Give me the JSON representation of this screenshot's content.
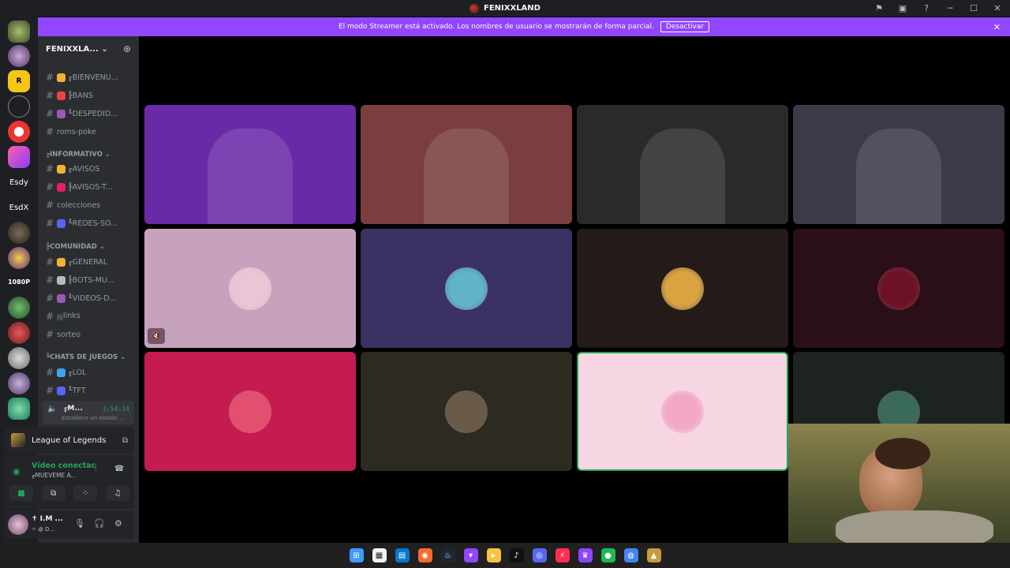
{
  "window": {
    "title": "FENIXXLAND",
    "controls": [
      "flag-icon",
      "inbox-icon",
      "help-icon",
      "minimize-icon",
      "maximize-icon",
      "close-icon"
    ],
    "control_glyphs": [
      "⚑",
      "▣",
      "?",
      "─",
      "☐",
      "✕"
    ]
  },
  "banner": {
    "message": "El modo Streamer está activado. Los nombres de usuario se mostrarán de forma parcial.",
    "button": "Desactivar",
    "close": "✕",
    "color": "#9146ff"
  },
  "rail": {
    "labels": [
      "Esdy",
      "EsdX",
      "1080P"
    ]
  },
  "guild": {
    "name": "FENIXXLA...",
    "chevron": "⌄",
    "add_icon": "⊕"
  },
  "channels": [
    {
      "label": "╓BIENVENU...",
      "color": "#f0b232"
    },
    {
      "label": "╟BANS",
      "color": "#f23f43"
    },
    {
      "label": "╙DESPEDID...",
      "color": "#9b59b6"
    },
    {
      "label": "roms-poke",
      "color": ""
    }
  ],
  "categories": [
    "╔INFORMATIVO ⌄",
    "╠COMUNIDAD ⌄",
    "╚CHATS DE JUEGOS ⌄"
  ],
  "info_channels": [
    {
      "label": "╓AVISOS",
      "color": "#f0b232"
    },
    {
      "label": "╟AVISOS-T...",
      "color": "#e91e63"
    },
    {
      "label": "colecciones",
      "color": ""
    },
    {
      "label": "╙REDES-SO...",
      "color": "#5865f2"
    }
  ],
  "community_channels": [
    {
      "label": "╓GENERAL",
      "color": "#f0b232"
    },
    {
      "label": "╟BOTS-MU...",
      "color": "#b5bac1"
    },
    {
      "label": "╙VIDEOS-D...",
      "color": "#9b59b6"
    },
    {
      "label": "ஜlinks",
      "color": ""
    },
    {
      "label": "sorteo",
      "color": ""
    }
  ],
  "games_channels": [
    {
      "label": "╓LOL",
      "color": "#3ba5f0"
    },
    {
      "label": "╙TFT",
      "color": "#5865f2"
    }
  ],
  "voice_channel": {
    "name": "╓M...",
    "time": "2:54:14",
    "sub": "Establece un estado ..."
  },
  "game_activity": {
    "title": "League of Legends"
  },
  "rtc": {
    "status": "Vídeo conectac",
    "channel": "╓MUEVEME A..."
  },
  "user": {
    "name": "✝ I.M ...",
    "status": "✧ ꩜ D..."
  },
  "tiles": [
    {
      "type": "video",
      "color": "#6a2aa8"
    },
    {
      "type": "video",
      "color": "#7a3e3e"
    },
    {
      "type": "video",
      "color": "#2a2a2a"
    },
    {
      "type": "video",
      "color": "#3b3a48"
    },
    {
      "type": "avatar",
      "color": "#c7a2bd",
      "avatar": "#e9c6d6",
      "muted": true
    },
    {
      "type": "avatar",
      "color": "#3b3162",
      "avatar": "#5fb4c8"
    },
    {
      "type": "avatar",
      "color": "#241a18",
      "avatar": "#d9a440"
    },
    {
      "type": "avatar",
      "color": "#2a0f18",
      "avatar": "#6d1226"
    },
    {
      "type": "avatar",
      "color": "#c51c50",
      "avatar": "#e24f6f"
    },
    {
      "type": "avatar",
      "color": "#2d2a22",
      "avatar": "#6a5a48"
    },
    {
      "type": "avatar",
      "color": "#f6d6e2",
      "avatar": "#f3a9c6",
      "speaking": true
    },
    {
      "type": "avatar",
      "color": "#1d2320",
      "avatar": "#3a6b5a"
    }
  ],
  "taskbar": [
    "windows-icon",
    "explorer-icon",
    "store-icon",
    "origin-icon",
    "steam-icon",
    "twitch-icon",
    "folder-icon",
    "tiktok-icon",
    "discord-icon",
    "bolt-icon",
    "app-icon",
    "spotify-icon",
    "chrome-icon",
    "lol-icon"
  ],
  "taskbar_glyphs": [
    "⊞",
    "▦",
    "▤",
    "◉",
    "♨",
    "▾",
    "▸",
    "♪",
    "◎",
    "⚡",
    "♛",
    "●",
    "◍",
    "▲"
  ],
  "taskbar_colors": [
    "#3b9cff",
    "#f4f4f4",
    "#0078d4",
    "#f56c2d",
    "#1b2838",
    "#9146ff",
    "#f5c542",
    "#111111",
    "#5865f2",
    "#ff2d55",
    "#8e44ff",
    "#1db954",
    "#4285f4",
    "#c89b3c"
  ]
}
